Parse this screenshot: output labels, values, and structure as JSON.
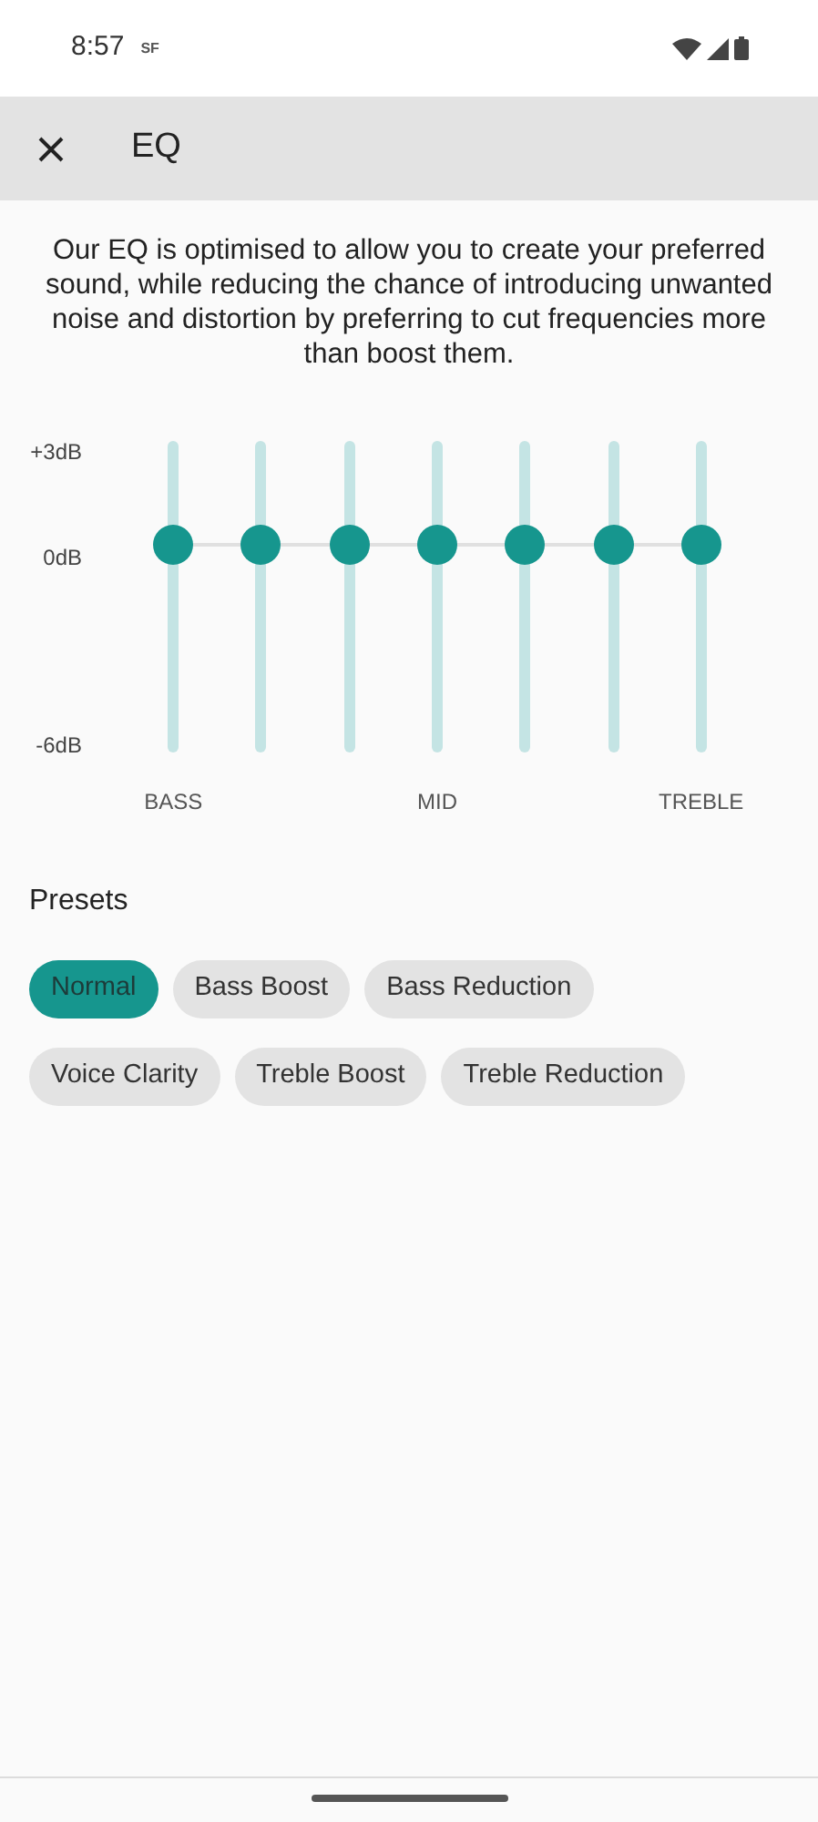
{
  "status_bar": {
    "time": "8:57",
    "badge": "SF"
  },
  "app_bar": {
    "title": "EQ"
  },
  "description": "Our EQ is optimised to allow you to create your preferred sound, while reducing the chance of introducing unwanted noise and distortion by preferring to cut frequencies more than boost them.",
  "eq": {
    "scale_labels": [
      "+3dB",
      "0dB",
      "-6dB"
    ],
    "bands": [
      {
        "level": 0.667,
        "label": "BASS"
      },
      {
        "level": 0.667
      },
      {
        "level": 0.667
      },
      {
        "level": 0.667,
        "label": "MID"
      },
      {
        "level": 0.667
      },
      {
        "level": 0.667
      },
      {
        "level": 0.667,
        "label": "TREBLE"
      }
    ]
  },
  "presets": {
    "heading": "Presets",
    "rows": [
      [
        {
          "label": "Normal",
          "selected": true
        },
        {
          "label": "Bass Boost",
          "selected": false
        },
        {
          "label": "Bass Reduction",
          "selected": false
        }
      ],
      [
        {
          "label": "Voice Clarity",
          "selected": false
        },
        {
          "label": "Treble Boost",
          "selected": false
        },
        {
          "label": "Treble Reduction",
          "selected": false
        }
      ]
    ]
  }
}
